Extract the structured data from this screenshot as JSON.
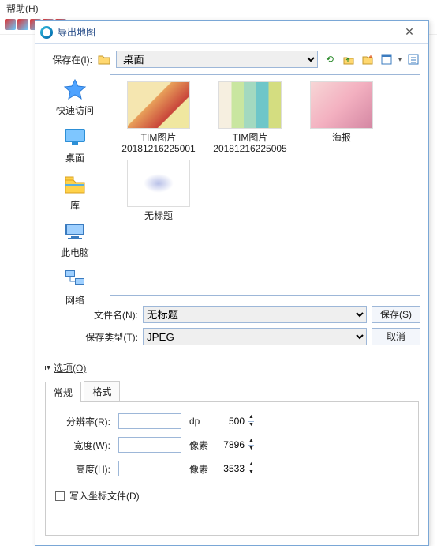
{
  "bg": {
    "help_menu": "帮助(H)"
  },
  "dialog": {
    "title": "导出地图",
    "save_in_label": "保存在(I):",
    "location_options": [
      "桌面"
    ],
    "location_selected": "桌面",
    "places": [
      {
        "key": "quick",
        "label": "快速访问"
      },
      {
        "key": "desktop",
        "label": "桌面"
      },
      {
        "key": "library",
        "label": "库"
      },
      {
        "key": "thispc",
        "label": "此电脑"
      },
      {
        "key": "network",
        "label": "网络"
      }
    ],
    "files": [
      {
        "label": "TIM图片20181216225001",
        "thumb": "th1"
      },
      {
        "label": "TIM图片20181216225005",
        "thumb": "th2"
      },
      {
        "label": "海报",
        "thumb": "th3"
      },
      {
        "label": "无标题",
        "thumb": "th4"
      }
    ],
    "filename_label": "文件名(N):",
    "filename_value": "无标题",
    "filetype_label": "保存类型(T):",
    "filetype_value": "JPEG",
    "save_btn": "保存(S)",
    "cancel_btn": "取消"
  },
  "options": {
    "toggle_label": "选项(O)",
    "tabs": [
      "常规",
      "格式"
    ],
    "active_tab": 0,
    "resolution_label": "分辨率(R):",
    "resolution_value": "500",
    "resolution_unit": "dp",
    "width_label": "宽度(W):",
    "width_value": "7896",
    "height_label": "高度(H):",
    "height_value": "3533",
    "pixels_unit": "像素",
    "write_world_label": "写入坐标文件(D)"
  }
}
